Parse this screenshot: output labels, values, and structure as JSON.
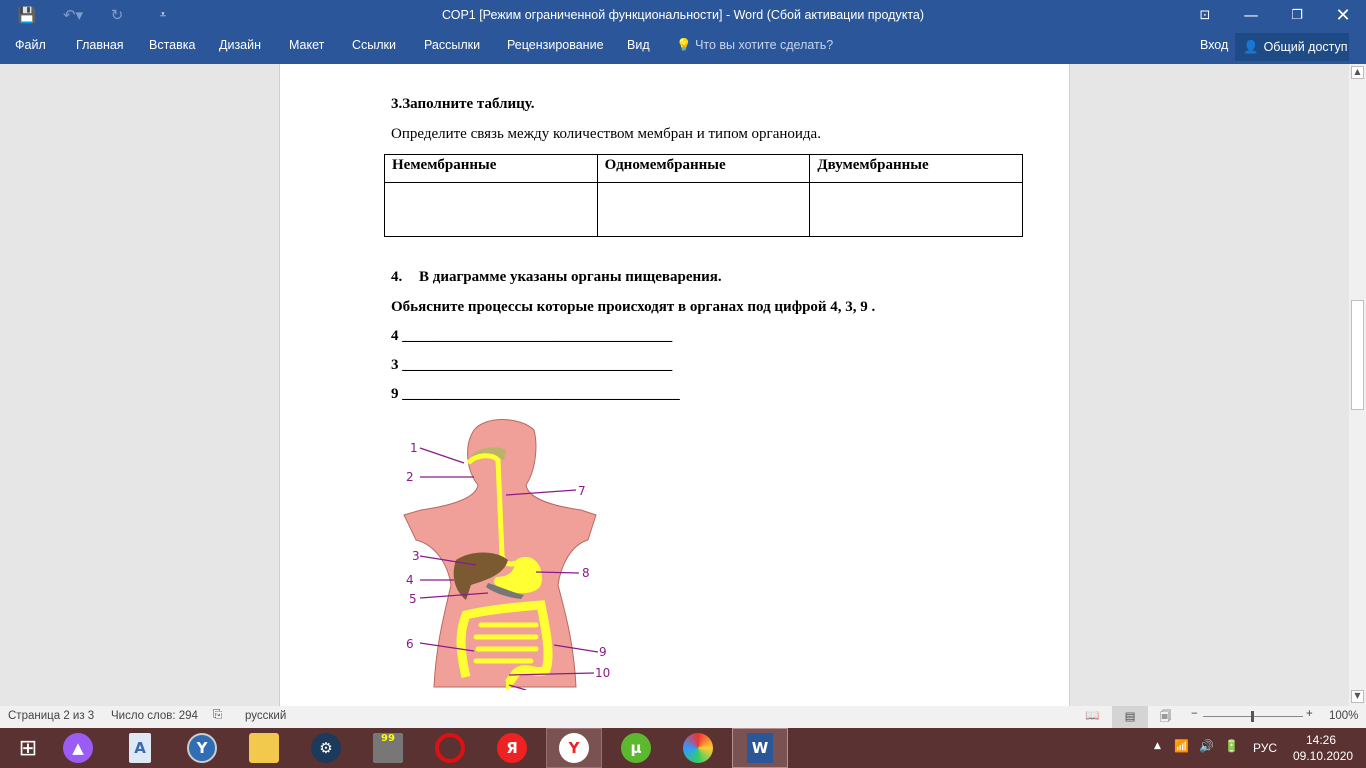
{
  "window": {
    "title": "СОР1 [Режим ограниченной функциональности] - Word (Сбой активации продукта)"
  },
  "ribbon": {
    "tabs": [
      "Файл",
      "Главная",
      "Вставка",
      "Дизайн",
      "Макет",
      "Ссылки",
      "Рассылки",
      "Рецензирование",
      "Вид"
    ],
    "tell_me": "Что вы хотите сделать?",
    "signin": "Вход",
    "share": "Общий доступ"
  },
  "doc": {
    "q3_title": "3.Заполните таблицу.",
    "q3_text": "Определите связь между количеством мембран и типом органоида.",
    "table_headers": [
      "Немембранные",
      "Одномембранные",
      "Двумембранные"
    ],
    "q4_num": "4.",
    "q4_title": "В диаграмме указаны органы пищеварения.",
    "q4_text": "Обьясните процессы которые происходят в органах под цифрой  4, 3, 9 .",
    "answers": [
      "4 ____________________________________",
      "3 ____________________________________",
      "9 _____________________________________"
    ],
    "diagram_labels": [
      "1",
      "2",
      "3",
      "4",
      "5",
      "6",
      "7",
      "8",
      "9",
      "10"
    ]
  },
  "status": {
    "page": "Страница 2 из 3",
    "words": "Число слов: 294",
    "language": "русский",
    "zoom": "100%",
    "zoom_percent": 100
  },
  "taskbar": {
    "lang": "РУС",
    "time": "14:26",
    "date": "09.10.2020",
    "badge": "99"
  }
}
